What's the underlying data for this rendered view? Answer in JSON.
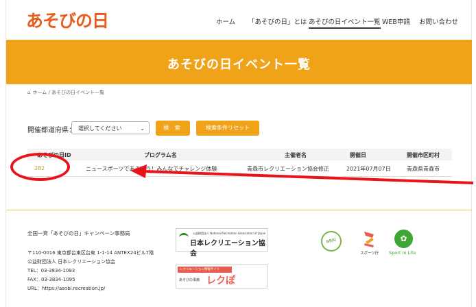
{
  "header": {
    "logo_text": "あそびの日",
    "nav": [
      "ホーム",
      "「あそびの日」とは",
      "あそびの日イベント一覧",
      "WEB申請",
      "お問い合わせ"
    ],
    "active_index": 2
  },
  "banner": {
    "title": "あそびの日イベント一覧"
  },
  "breadcrumb": {
    "home": "ホーム",
    "separator": "/",
    "current": "あそびの日イベント一覧"
  },
  "search": {
    "prefecture_label": "開催都道府県：",
    "prefecture_value": "選択してください",
    "search_button": "検 索",
    "reset_button": "検索条件リセット"
  },
  "table": {
    "headers": [
      "あそびの日ID",
      "プログラム名",
      "主催者名",
      "開催日",
      "開催市区町村"
    ],
    "rows": [
      [
        "382",
        "ニュースポーツであそぼう！みんなでチャレンジ体験",
        "青森市レクリエーション協会修正",
        "2021年07月07日",
        "青森県青森市"
      ]
    ]
  },
  "footer": {
    "org_title": "全国一斉「あそびの日」キャンペーン事務局",
    "address1": "〒110-0016 東京都台東区台東 1-1-14 ANTEX24ビル7階",
    "address2": "公益財団法人 日本レクリエーション協会",
    "tel": "TEL：03-3834-1093",
    "fax": "FAX：03-3834-1095",
    "url": "URL：https://asobi.recreation.jp/",
    "nrec_small": "公益財団法人 National Recreation Association of Japan",
    "nrec_main": "日本レクリエーション協会",
    "reku_tag": "レクリエーション情報サイト",
    "reku_sub": "あそびの事典",
    "reku_big": "レクぽ",
    "nrai_text": "NRAJ",
    "sports_agency": "スポーツ庁",
    "sport_in_life": "Sport in Life"
  },
  "colors": {
    "accent": "#f0a218",
    "logo": "#e85b1e",
    "annotation": "#e8141c"
  }
}
